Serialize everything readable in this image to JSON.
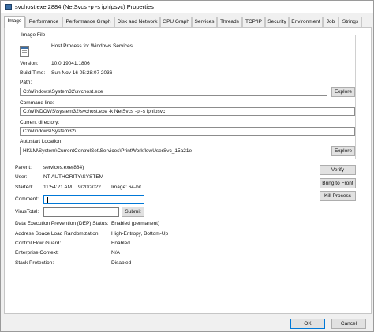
{
  "window": {
    "title": "svchost.exe:2884 (NetSvcs -p -s iphlpsvc) Properties"
  },
  "tabs": [
    {
      "label": "Image",
      "active": true
    },
    {
      "label": "Performance"
    },
    {
      "label": "Performance Graph"
    },
    {
      "label": "Disk and Network"
    },
    {
      "label": "GPU Graph"
    },
    {
      "label": "Services"
    },
    {
      "label": "Threads"
    },
    {
      "label": "TCP/IP"
    },
    {
      "label": "Security"
    },
    {
      "label": "Environment"
    },
    {
      "label": "Job"
    },
    {
      "label": "Strings"
    }
  ],
  "image_file": {
    "group_label": "Image File",
    "description": "Host Process for Windows Services",
    "version_label": "Version:",
    "version": "10.0.19041.1806",
    "build_time_label": "Build Time:",
    "build_time": "Sun Nov 16 05:28:07 2036",
    "path_label": "Path:",
    "path": "C:\\Windows\\System32\\svchost.exe",
    "command_line_label": "Command line:",
    "command_line": "C:\\WINDOWS\\system32\\svchost.exe -k NetSvcs -p -s iphlpsvc",
    "current_directory_label": "Current directory:",
    "current_directory": "C:\\Windows\\System32\\",
    "autostart_label": "Autostart Location:",
    "autostart": "HKLM\\System\\CurrentControlSet\\Services\\PrintWorkflowUserSvc_15a21e",
    "explore_label": "Explore"
  },
  "process": {
    "parent_label": "Parent:",
    "parent": "services.exe(884)",
    "user_label": "User:",
    "user": "NT AUTHORITY\\SYSTEM",
    "started_label": "Started:",
    "started_time": "11:54:21 AM",
    "started_date": "9/20/2022",
    "image_label": "Image: 64-bit",
    "comment_label": "Comment:",
    "virustotal_label": "VirusTotal:",
    "submit_label": "Submit"
  },
  "side_buttons": {
    "verify": "Verify",
    "bring_to_front": "Bring to Front",
    "kill_process": "Kill Process"
  },
  "security": {
    "dep_label": "Data Execution Prevention (DEP) Status:",
    "dep_value": "Enabled (permanent)",
    "aslr_label": "Address Space Load Randomization:",
    "aslr_value": "High-Entropy, Bottom-Up",
    "cfg_label": "Control Flow Guard:",
    "cfg_value": "Enabled",
    "enterprise_label": "Enterprise Context:",
    "enterprise_value": "N/A",
    "stack_label": "Stack Protection:",
    "stack_value": "Disabled"
  },
  "dialog_buttons": {
    "ok": "OK",
    "cancel": "Cancel"
  }
}
